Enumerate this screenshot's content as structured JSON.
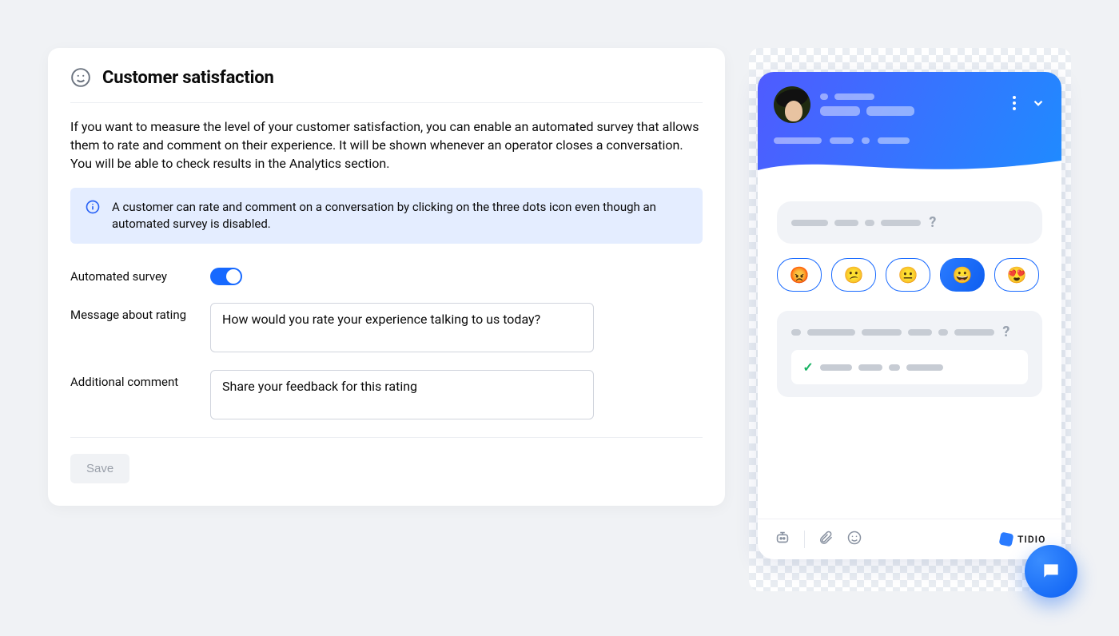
{
  "header": {
    "title": "Customer satisfaction"
  },
  "description": "If you want to measure the level of your customer satisfaction, you can enable an automated survey that allows them to rate and comment on their experience. It will be shown whenever an operator closes a conversation. You will be able to check results in the Analytics section.",
  "info_banner": "A customer can rate and comment on a conversation by clicking on the three dots icon even though an automated survey is disabled.",
  "fields": {
    "automated_survey": {
      "label": "Automated survey",
      "enabled": true
    },
    "rating_message": {
      "label": "Message about rating",
      "value": "How would you rate your experience talking to us today?"
    },
    "additional_comment": {
      "label": "Additional comment",
      "value": "Share your feedback for this rating"
    }
  },
  "buttons": {
    "save": "Save"
  },
  "preview": {
    "emojis": [
      "😡",
      "😕",
      "😐",
      "😀",
      "😍"
    ],
    "selected_emoji_index": 3,
    "brand": "TIDIO"
  }
}
